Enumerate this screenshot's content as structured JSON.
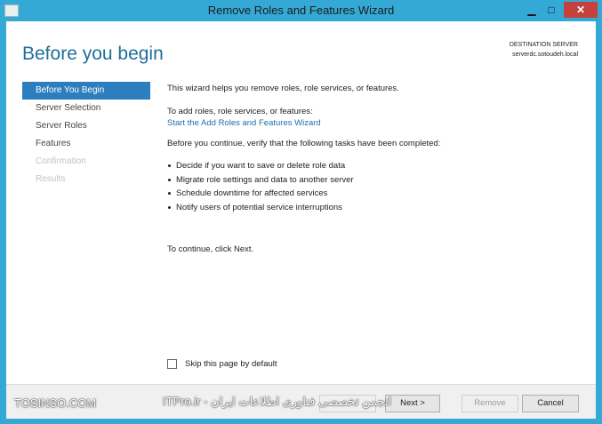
{
  "window": {
    "title": "Remove Roles and Features Wizard",
    "minimize": "▁",
    "maximize": "□",
    "close": "✕"
  },
  "header": {
    "title": "Before you begin",
    "destination_label": "DESTINATION SERVER",
    "destination_server": "serverdc.sotoudeh.local"
  },
  "nav": {
    "items": [
      {
        "label": "Before You Begin"
      },
      {
        "label": "Server Selection"
      },
      {
        "label": "Server Roles"
      },
      {
        "label": "Features"
      },
      {
        "label": "Confirmation"
      },
      {
        "label": "Results"
      }
    ]
  },
  "content": {
    "intro": "This wizard helps you remove roles, role services, or features.",
    "add_label": "To add roles, role services, or features:",
    "add_link": "Start the Add Roles and Features Wizard",
    "verify": "Before you continue, verify that the following tasks have been completed:",
    "bullets": [
      "Decide if you want to save or delete role data",
      "Migrate role settings and data to another server",
      "Schedule downtime for affected services",
      "Notify users of potential service interruptions"
    ],
    "continue": "To continue, click Next."
  },
  "skip_label": "Skip this page by default",
  "buttons": {
    "next": "Next >",
    "remove": "Remove",
    "cancel": "Cancel"
  },
  "watermark": {
    "left": "TOSINSO.COM",
    "right": "انجمن تخصصی فناوری اطلاعات ایران - ITPro.ir"
  }
}
